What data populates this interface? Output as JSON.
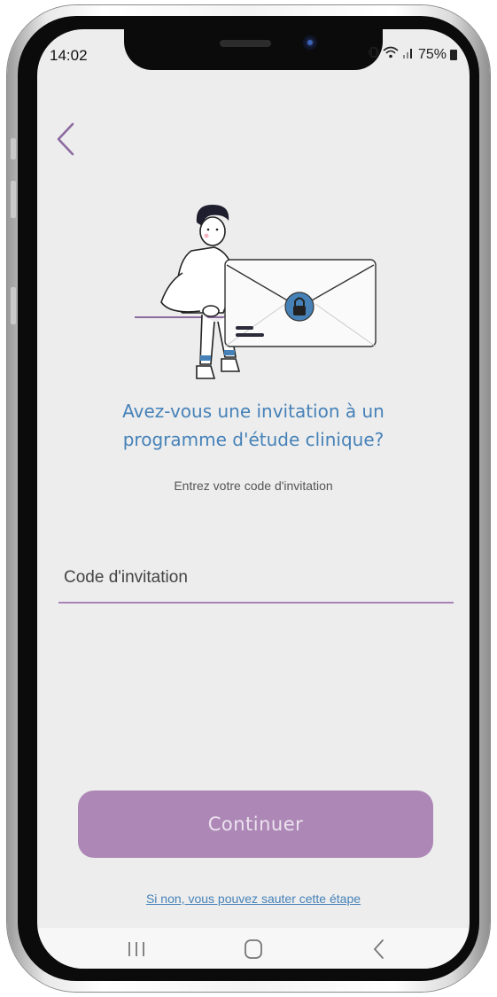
{
  "status_bar": {
    "time": "14:02",
    "battery": "75%",
    "icons": [
      "vibrate-icon",
      "wifi-icon",
      "signal-icon",
      "battery-icon"
    ]
  },
  "header": {
    "back_icon": "chevron-left-icon"
  },
  "illustration": {
    "icon": "person-with-locked-envelope-illustration"
  },
  "main": {
    "question_line1": "Avez-vous une invitation à un",
    "question_line2": "programme d'étude clinique?",
    "subtitle": "Entrez votre code d'invitation",
    "code_placeholder": "Code d'invitation",
    "code_value": ""
  },
  "actions": {
    "continue_label": "Continuer",
    "skip_label": "Si non, vous pouvez sauter cette étape"
  },
  "navbar": {
    "icons": [
      "recent-apps-icon",
      "home-icon",
      "back-icon"
    ]
  },
  "colors": {
    "accent_purple": "#ad88b6",
    "title_blue": "#4682b8",
    "background": "#ededed"
  }
}
